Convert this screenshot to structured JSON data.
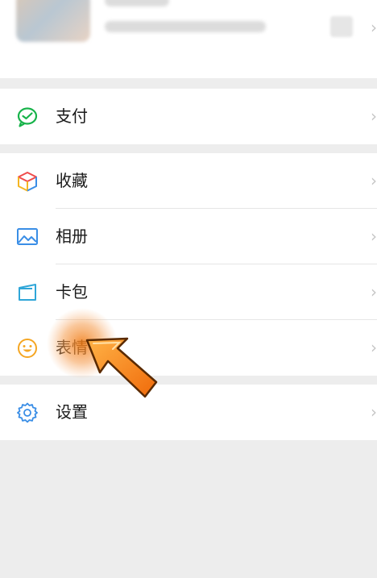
{
  "menu": {
    "pay": {
      "label": "支付",
      "icon": "wechat-pay-icon",
      "color": "#17b34a"
    },
    "favorites": {
      "label": "收藏",
      "icon": "cube-icon"
    },
    "album": {
      "label": "相册",
      "icon": "image-icon",
      "color": "#3a8ee6"
    },
    "cards": {
      "label": "卡包",
      "icon": "card-wallet-icon",
      "color": "#2fa6d8"
    },
    "stickers": {
      "label": "表情",
      "icon": "smiley-icon",
      "color": "#f5a623"
    },
    "settings": {
      "label": "设置",
      "icon": "gear-icon",
      "color": "#3a8ee6"
    }
  },
  "chevron": "›",
  "pointer_color": "#f07a12"
}
